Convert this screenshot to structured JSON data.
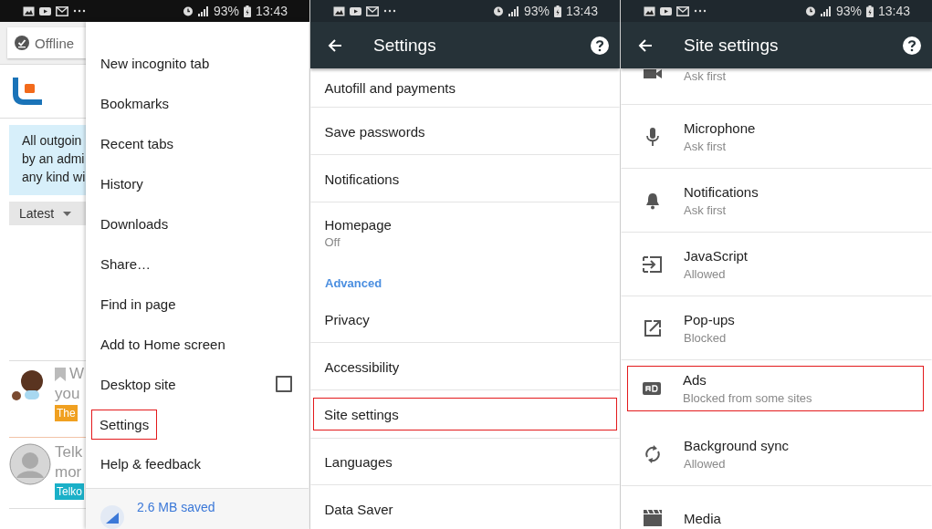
{
  "browser_panel": {
    "status_bar": {
      "battery": "93%",
      "time": "13:43"
    },
    "page": {
      "offline_chip": "Offline",
      "notice_lines": [
        "All outgoin",
        "by an admi",
        "any kind wi"
      ],
      "sort_dropdown": "Latest",
      "feed": [
        {
          "title": "W",
          "line2": "you",
          "tag": "The",
          "color": "#f0a020",
          "bookmarked": true
        },
        {
          "title": "Telk",
          "line2": "mor",
          "tag": "Telko",
          "color": "#1ab0c8",
          "bookmarked": false
        }
      ]
    },
    "menu": {
      "items": [
        {
          "label": "New incognito tab",
          "kind": "plain",
          "highlighted": false
        },
        {
          "label": "Bookmarks",
          "kind": "plain",
          "highlighted": false
        },
        {
          "label": "Recent tabs",
          "kind": "plain",
          "highlighted": false
        },
        {
          "label": "History",
          "kind": "plain",
          "highlighted": false
        },
        {
          "label": "Downloads",
          "kind": "plain",
          "highlighted": false
        },
        {
          "label": "Share…",
          "kind": "plain",
          "highlighted": false
        },
        {
          "label": "Find in page",
          "kind": "plain",
          "highlighted": false
        },
        {
          "label": "Add to Home screen",
          "kind": "plain",
          "highlighted": false
        },
        {
          "label": "Desktop site",
          "kind": "checkbox",
          "checked": false,
          "highlighted": false
        },
        {
          "label": "Settings",
          "kind": "plain",
          "highlighted": true
        },
        {
          "label": "Help & feedback",
          "kind": "plain",
          "highlighted": false
        }
      ],
      "footer": "2.6 MB saved"
    }
  },
  "settings_panel": {
    "status_bar": {
      "battery": "93%",
      "time": "13:43"
    },
    "title": "Settings",
    "items": [
      {
        "kind": "item",
        "label": "Autofill and payments",
        "highlighted": false
      },
      {
        "kind": "item",
        "label": "Save passwords",
        "highlighted": false
      },
      {
        "kind": "item",
        "label": "Notifications",
        "highlighted": false
      },
      {
        "kind": "item",
        "label": "Homepage",
        "subtitle": "Off",
        "highlighted": false
      },
      {
        "kind": "header",
        "label": "Advanced"
      },
      {
        "kind": "item",
        "label": "Privacy",
        "highlighted": false
      },
      {
        "kind": "item",
        "label": "Accessibility",
        "highlighted": false
      },
      {
        "kind": "item",
        "label": "Site settings",
        "highlighted": true
      },
      {
        "kind": "item",
        "label": "Languages",
        "highlighted": false
      },
      {
        "kind": "item",
        "label": "Data Saver",
        "highlighted": false
      }
    ]
  },
  "site_settings_panel": {
    "status_bar": {
      "battery": "93%",
      "time": "13:43"
    },
    "title": "Site settings",
    "items": [
      {
        "subtitle": "Ask first",
        "highlighted": false
      },
      {
        "label": "Microphone",
        "subtitle": "Ask first",
        "highlighted": false
      },
      {
        "label": "Notifications",
        "subtitle": "Ask first",
        "highlighted": false
      },
      {
        "label": "JavaScript",
        "subtitle": "Allowed",
        "highlighted": false
      },
      {
        "label": "Pop-ups",
        "subtitle": "Blocked",
        "highlighted": false
      },
      {
        "label": "Ads",
        "subtitle": "Blocked from some sites",
        "highlighted": true
      },
      {
        "label": "Background sync",
        "subtitle": "Allowed",
        "highlighted": false
      },
      {
        "label": "Media",
        "highlighted": false
      }
    ]
  }
}
